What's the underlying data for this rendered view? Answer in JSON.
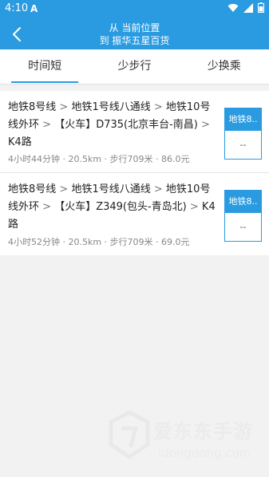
{
  "status": {
    "time": "4:10",
    "notification_letter": "A",
    "icons": [
      "wifi-icon",
      "cell-signal-icon",
      "battery-icon"
    ]
  },
  "header": {
    "title_line1": "从 当前位置",
    "title_line2": "到 振华五星百货",
    "back_icon": "chevron-left-icon"
  },
  "tabs": [
    {
      "label": "时间短",
      "active": true
    },
    {
      "label": "少步行",
      "active": false
    },
    {
      "label": "少换乘",
      "active": false
    }
  ],
  "routes": [
    {
      "segments": [
        {
          "t": "地铁8号线",
          "s": false
        },
        {
          "t": " > ",
          "s": true
        },
        {
          "t": "地铁1号线八通线",
          "s": false
        },
        {
          "t": " > ",
          "s": true
        },
        {
          "t": "地铁10号线外环",
          "s": false
        },
        {
          "t": " > ",
          "s": true
        },
        {
          "t": "【火车】D735(北京丰台-南昌)",
          "s": false
        },
        {
          "t": " > ",
          "s": true
        },
        {
          "t": "K4路",
          "s": false
        }
      ],
      "meta": "4小时44分钟 · 20.5km · 步行709米 · 86.0元",
      "side_label": "地铁8..",
      "side_value": "--"
    },
    {
      "segments": [
        {
          "t": "地铁8号线",
          "s": false
        },
        {
          "t": " > ",
          "s": true
        },
        {
          "t": "地铁1号线八通线",
          "s": false
        },
        {
          "t": " > ",
          "s": true
        },
        {
          "t": "地铁10号线外环",
          "s": false
        },
        {
          "t": " > ",
          "s": true
        },
        {
          "t": "【火车】Z349(包头-青岛北)",
          "s": false
        },
        {
          "t": " > ",
          "s": true
        },
        {
          "t": "K4路",
          "s": false
        }
      ],
      "meta": "4小时52分钟 · 20.5km · 步行709米 · 69.0元",
      "side_label": "地铁8..",
      "side_value": "--"
    }
  ],
  "watermark": {
    "title": "爱东东手游",
    "subtitle": "idongdong.com"
  },
  "colors": {
    "primary": "#2a9be0",
    "background": "#f2f2f2",
    "text": "#222222",
    "muted": "#888888"
  }
}
